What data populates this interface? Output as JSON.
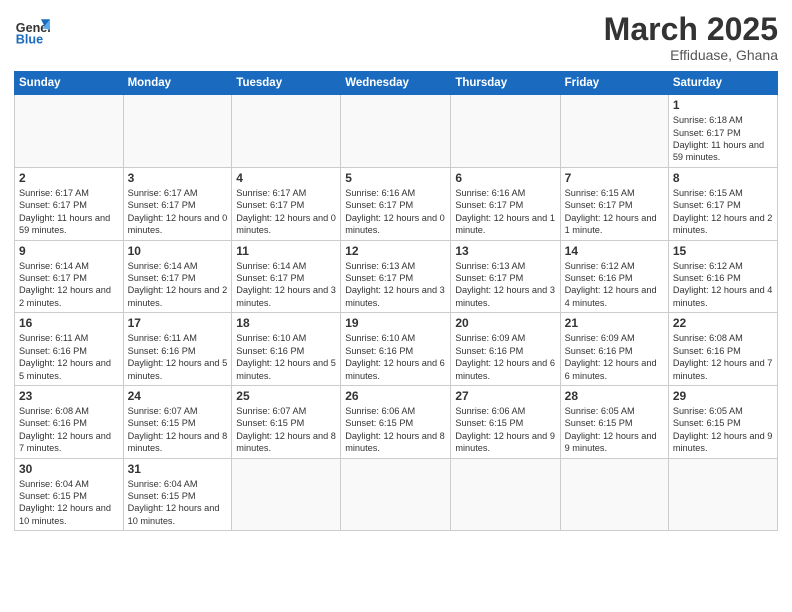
{
  "header": {
    "logo_general": "General",
    "logo_blue": "Blue",
    "month": "March 2025",
    "location": "Effiduase, Ghana"
  },
  "days_of_week": [
    "Sunday",
    "Monday",
    "Tuesday",
    "Wednesday",
    "Thursday",
    "Friday",
    "Saturday"
  ],
  "weeks": [
    [
      {
        "day": "",
        "info": ""
      },
      {
        "day": "",
        "info": ""
      },
      {
        "day": "",
        "info": ""
      },
      {
        "day": "",
        "info": ""
      },
      {
        "day": "",
        "info": ""
      },
      {
        "day": "",
        "info": ""
      },
      {
        "day": "1",
        "info": "Sunrise: 6:18 AM\nSunset: 6:17 PM\nDaylight: 11 hours\nand 59 minutes."
      }
    ],
    [
      {
        "day": "2",
        "info": "Sunrise: 6:17 AM\nSunset: 6:17 PM\nDaylight: 11 hours\nand 59 minutes."
      },
      {
        "day": "3",
        "info": "Sunrise: 6:17 AM\nSunset: 6:17 PM\nDaylight: 12 hours\nand 0 minutes."
      },
      {
        "day": "4",
        "info": "Sunrise: 6:17 AM\nSunset: 6:17 PM\nDaylight: 12 hours\nand 0 minutes."
      },
      {
        "day": "5",
        "info": "Sunrise: 6:16 AM\nSunset: 6:17 PM\nDaylight: 12 hours\nand 0 minutes."
      },
      {
        "day": "6",
        "info": "Sunrise: 6:16 AM\nSunset: 6:17 PM\nDaylight: 12 hours\nand 1 minute."
      },
      {
        "day": "7",
        "info": "Sunrise: 6:15 AM\nSunset: 6:17 PM\nDaylight: 12 hours\nand 1 minute."
      },
      {
        "day": "8",
        "info": "Sunrise: 6:15 AM\nSunset: 6:17 PM\nDaylight: 12 hours\nand 2 minutes."
      }
    ],
    [
      {
        "day": "9",
        "info": "Sunrise: 6:14 AM\nSunset: 6:17 PM\nDaylight: 12 hours\nand 2 minutes."
      },
      {
        "day": "10",
        "info": "Sunrise: 6:14 AM\nSunset: 6:17 PM\nDaylight: 12 hours\nand 2 minutes."
      },
      {
        "day": "11",
        "info": "Sunrise: 6:14 AM\nSunset: 6:17 PM\nDaylight: 12 hours\nand 3 minutes."
      },
      {
        "day": "12",
        "info": "Sunrise: 6:13 AM\nSunset: 6:17 PM\nDaylight: 12 hours\nand 3 minutes."
      },
      {
        "day": "13",
        "info": "Sunrise: 6:13 AM\nSunset: 6:17 PM\nDaylight: 12 hours\nand 3 minutes."
      },
      {
        "day": "14",
        "info": "Sunrise: 6:12 AM\nSunset: 6:16 PM\nDaylight: 12 hours\nand 4 minutes."
      },
      {
        "day": "15",
        "info": "Sunrise: 6:12 AM\nSunset: 6:16 PM\nDaylight: 12 hours\nand 4 minutes."
      }
    ],
    [
      {
        "day": "16",
        "info": "Sunrise: 6:11 AM\nSunset: 6:16 PM\nDaylight: 12 hours\nand 5 minutes."
      },
      {
        "day": "17",
        "info": "Sunrise: 6:11 AM\nSunset: 6:16 PM\nDaylight: 12 hours\nand 5 minutes."
      },
      {
        "day": "18",
        "info": "Sunrise: 6:10 AM\nSunset: 6:16 PM\nDaylight: 12 hours\nand 5 minutes."
      },
      {
        "day": "19",
        "info": "Sunrise: 6:10 AM\nSunset: 6:16 PM\nDaylight: 12 hours\nand 6 minutes."
      },
      {
        "day": "20",
        "info": "Sunrise: 6:09 AM\nSunset: 6:16 PM\nDaylight: 12 hours\nand 6 minutes."
      },
      {
        "day": "21",
        "info": "Sunrise: 6:09 AM\nSunset: 6:16 PM\nDaylight: 12 hours\nand 6 minutes."
      },
      {
        "day": "22",
        "info": "Sunrise: 6:08 AM\nSunset: 6:16 PM\nDaylight: 12 hours\nand 7 minutes."
      }
    ],
    [
      {
        "day": "23",
        "info": "Sunrise: 6:08 AM\nSunset: 6:16 PM\nDaylight: 12 hours\nand 7 minutes."
      },
      {
        "day": "24",
        "info": "Sunrise: 6:07 AM\nSunset: 6:15 PM\nDaylight: 12 hours\nand 8 minutes."
      },
      {
        "day": "25",
        "info": "Sunrise: 6:07 AM\nSunset: 6:15 PM\nDaylight: 12 hours\nand 8 minutes."
      },
      {
        "day": "26",
        "info": "Sunrise: 6:06 AM\nSunset: 6:15 PM\nDaylight: 12 hours\nand 8 minutes."
      },
      {
        "day": "27",
        "info": "Sunrise: 6:06 AM\nSunset: 6:15 PM\nDaylight: 12 hours\nand 9 minutes."
      },
      {
        "day": "28",
        "info": "Sunrise: 6:05 AM\nSunset: 6:15 PM\nDaylight: 12 hours\nand 9 minutes."
      },
      {
        "day": "29",
        "info": "Sunrise: 6:05 AM\nSunset: 6:15 PM\nDaylight: 12 hours\nand 9 minutes."
      }
    ],
    [
      {
        "day": "30",
        "info": "Sunrise: 6:04 AM\nSunset: 6:15 PM\nDaylight: 12 hours\nand 10 minutes."
      },
      {
        "day": "31",
        "info": "Sunrise: 6:04 AM\nSunset: 6:15 PM\nDaylight: 12 hours\nand 10 minutes."
      },
      {
        "day": "",
        "info": ""
      },
      {
        "day": "",
        "info": ""
      },
      {
        "day": "",
        "info": ""
      },
      {
        "day": "",
        "info": ""
      },
      {
        "day": "",
        "info": ""
      }
    ]
  ]
}
